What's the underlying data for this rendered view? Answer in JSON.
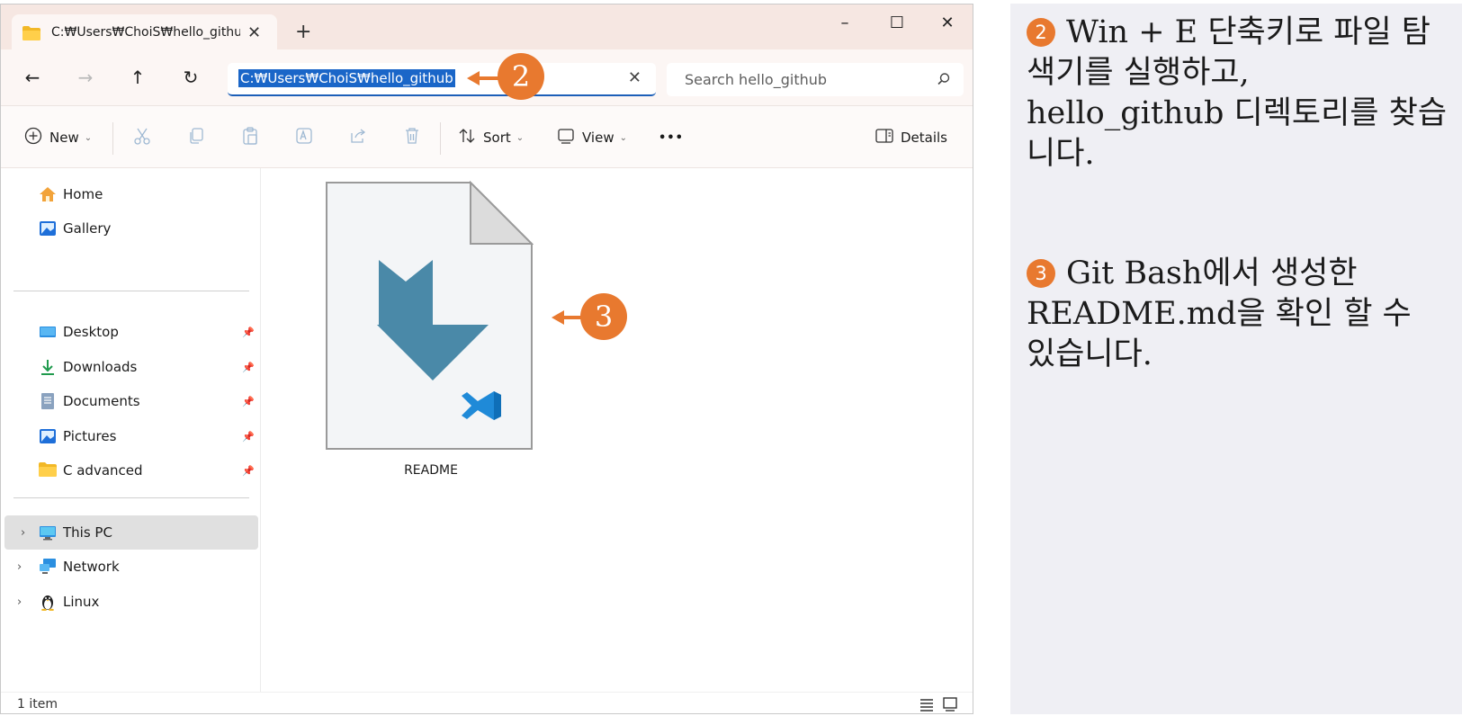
{
  "window": {
    "tab_title": "C:₩Users₩ChoiS₩hello_githu",
    "new_tab": "+",
    "minimize": "–",
    "maximize": "☐",
    "close": "✕"
  },
  "nav": {
    "back": "←",
    "forward": "→",
    "up": "↑",
    "refresh": "↻",
    "address": "C:₩Users₩ChoiS₩hello_github",
    "address_clear": "✕",
    "search_placeholder": "Search hello_github"
  },
  "toolbar": {
    "new": "New",
    "sort": "Sort",
    "view": "View",
    "more": "•••",
    "details": "Details"
  },
  "sidebar": {
    "quick": [
      {
        "label": "Home",
        "icon": "home-icon"
      },
      {
        "label": "Gallery",
        "icon": "gallery-icon"
      }
    ],
    "pinned": [
      {
        "label": "Desktop",
        "icon": "desktop-icon"
      },
      {
        "label": "Downloads",
        "icon": "download-icon"
      },
      {
        "label": "Documents",
        "icon": "documents-icon"
      },
      {
        "label": "Pictures",
        "icon": "pictures-icon"
      },
      {
        "label": "C advanced",
        "icon": "folder-icon"
      }
    ],
    "tree": [
      {
        "label": "This PC",
        "icon": "pc-icon",
        "selected": true
      },
      {
        "label": "Network",
        "icon": "network-icon"
      },
      {
        "label": "Linux",
        "icon": "linux-penguin-icon"
      }
    ]
  },
  "content": {
    "files": [
      {
        "name": "README",
        "icon": "vscode-markdown-file-icon"
      }
    ]
  },
  "status": {
    "item_count": "1 item"
  },
  "annotations": {
    "badge_2": "2",
    "badge_3": "3"
  },
  "panel": {
    "step2_num": "2",
    "step2_text": "Win + E 단축키로 파일 탐색기를 실행하고, hello_github 디렉토리를 찾습니다.",
    "step3_num": "3",
    "step3_text": "Git Bash에서 생성한 README.md을 확인 할 수 있습니다."
  },
  "colors": {
    "accent_orange": "#e8792f",
    "selection_blue": "#1a66c8",
    "title_bar": "#f6e7e2",
    "vscode_blue": "#1f8ad8",
    "arrow_teal": "#4a89a8"
  }
}
